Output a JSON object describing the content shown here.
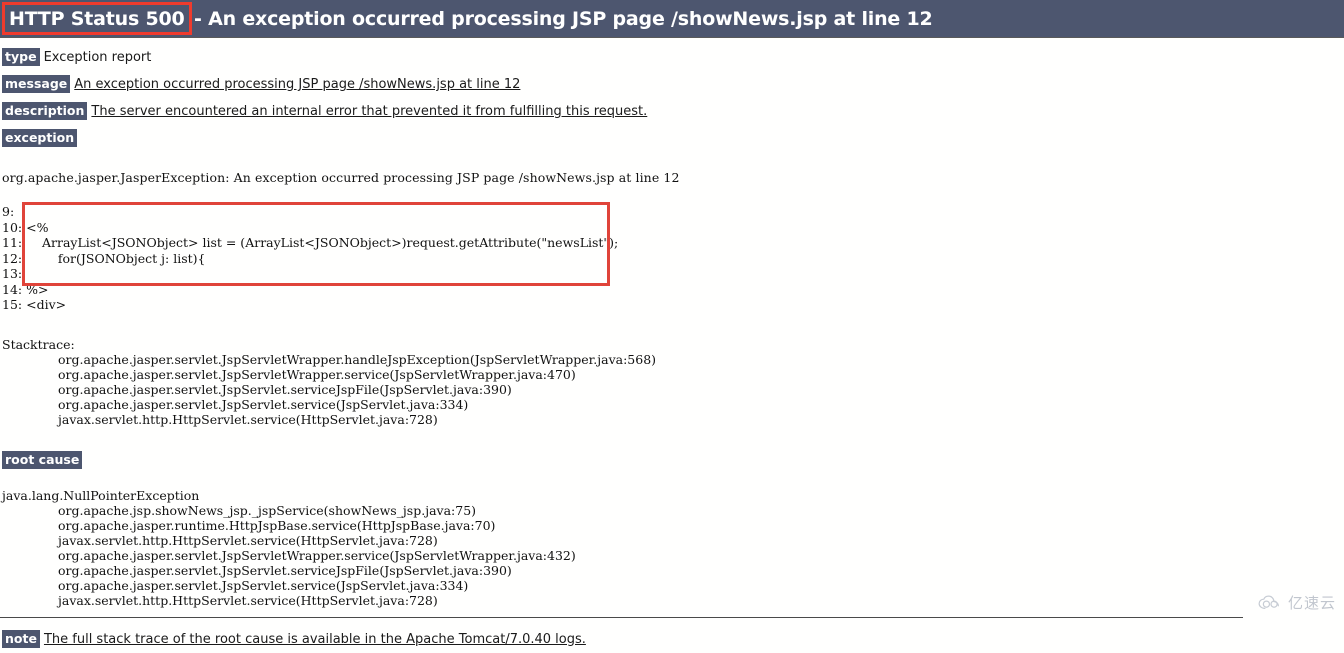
{
  "header": {
    "status": "HTTP Status 500",
    "separator": " - ",
    "message": "An exception occurred processing JSP page /showNews.jsp at line 12",
    "background_color": "#4d566f",
    "text_color": "#ffffff",
    "annotation_color": "#ef3b2d"
  },
  "report": {
    "type_label": "type",
    "type_value": "Exception report",
    "message_label": "message",
    "message_value": "An exception occurred processing JSP page /showNews.jsp at line 12",
    "description_label": "description",
    "description_value": "The server encountered an internal error that prevented it from fulfilling this request.",
    "exception_label": "exception",
    "exception_value": "org.apache.jasper.JasperException: An exception occurred processing JSP page /showNews.jsp at line 12"
  },
  "code_listing": {
    "annotation_color": "#e0443a",
    "lines": [
      {
        "num": "9:",
        "text": ""
      },
      {
        "num": "10:",
        "text": "<%"
      },
      {
        "num": "11:",
        "text": "    ArrayList<JSONObject> list = (ArrayList<JSONObject>)request.getAttribute(\"newsList\");"
      },
      {
        "num": "12:",
        "text": "        for(JSONObject j: list){"
      },
      {
        "num": "13:",
        "text": ""
      },
      {
        "num": "14:",
        "text": "%>"
      },
      {
        "num": "15:",
        "text": "<div>"
      }
    ]
  },
  "stacktrace": {
    "heading": "Stacktrace:",
    "frames": [
      "org.apache.jasper.servlet.JspServletWrapper.handleJspException(JspServletWrapper.java:568)",
      "org.apache.jasper.servlet.JspServletWrapper.service(JspServletWrapper.java:470)",
      "org.apache.jasper.servlet.JspServlet.serviceJspFile(JspServlet.java:390)",
      "org.apache.jasper.servlet.JspServlet.service(JspServlet.java:334)",
      "javax.servlet.http.HttpServlet.service(HttpServlet.java:728)"
    ]
  },
  "root_cause": {
    "label": "root cause",
    "exception": "java.lang.NullPointerException",
    "frames": [
      "org.apache.jsp.showNews_jsp._jspService(showNews_jsp.java:75)",
      "org.apache.jasper.runtime.HttpJspBase.service(HttpJspBase.java:70)",
      "javax.servlet.http.HttpServlet.service(HttpServlet.java:728)",
      "org.apache.jasper.servlet.JspServletWrapper.service(JspServletWrapper.java:432)",
      "org.apache.jasper.servlet.JspServlet.serviceJspFile(JspServlet.java:390)",
      "org.apache.jasper.servlet.JspServlet.service(JspServlet.java:334)",
      "javax.servlet.http.HttpServlet.service(HttpServlet.java:728)"
    ]
  },
  "note": {
    "label": "note",
    "value": "The full stack trace of the root cause is available in the Apache Tomcat/7.0.40 logs."
  },
  "watermark": {
    "icon": "cloud-icon",
    "text": "亿速云",
    "color": "#8f98a8"
  }
}
